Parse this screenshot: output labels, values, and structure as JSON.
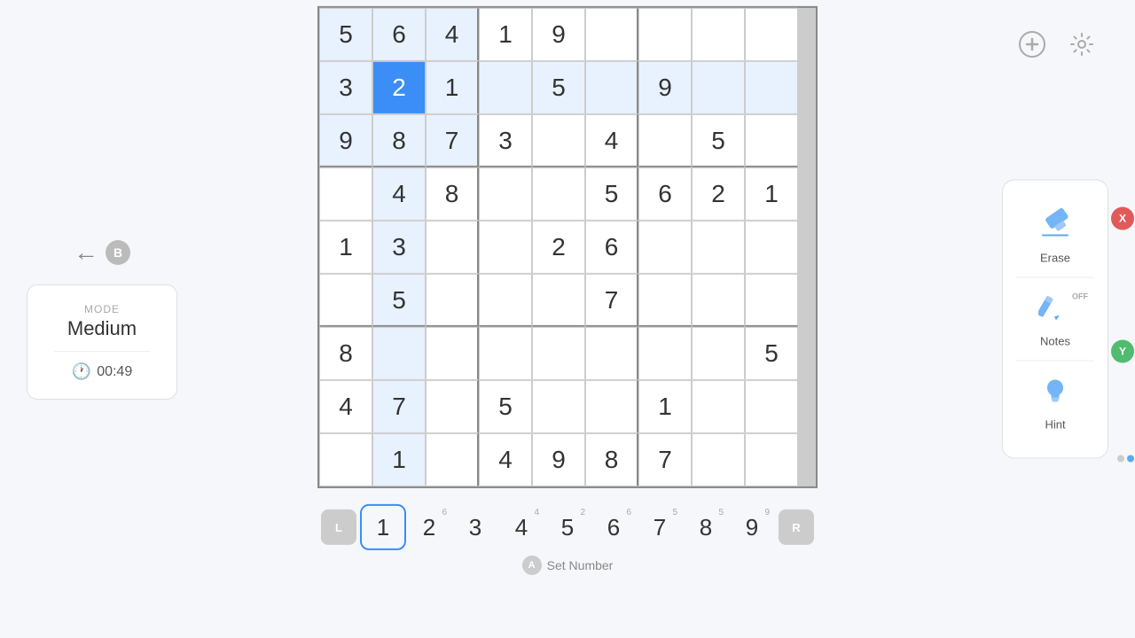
{
  "left": {
    "back_arrow": "←",
    "b_badge": "B",
    "mode_label": "MODE",
    "mode_value": "Medium",
    "timer_time": "00:49"
  },
  "top_right": {
    "add_label": "+",
    "settings_label": "⚙"
  },
  "tools": {
    "erase_label": "Erase",
    "notes_label": "Notes",
    "notes_status": "OFF",
    "hint_label": "Hint",
    "x_badge": "X",
    "y_badge": "Y"
  },
  "grid": {
    "cells": [
      [
        5,
        6,
        4,
        1,
        9,
        "",
        "",
        "",
        ""
      ],
      [
        3,
        2,
        1,
        "",
        5,
        "",
        9,
        "",
        ""
      ],
      [
        9,
        8,
        7,
        3,
        "",
        4,
        "",
        5,
        ""
      ],
      [
        "",
        4,
        8,
        "",
        "",
        5,
        6,
        2,
        1
      ],
      [
        1,
        3,
        "",
        "",
        2,
        6,
        "",
        "",
        ""
      ],
      [
        "",
        5,
        "",
        "",
        "",
        7,
        "",
        "",
        ""
      ],
      [
        8,
        "",
        "",
        "",
        "",
        "",
        "",
        "",
        5
      ],
      [
        4,
        7,
        "",
        5,
        "",
        "",
        1,
        "",
        ""
      ],
      [
        "",
        1,
        "",
        4,
        9,
        8,
        7,
        "",
        ""
      ]
    ],
    "selected_row": 1,
    "selected_col": 1,
    "highlighted_rows_cols": []
  },
  "number_picker": {
    "left_btn": "L",
    "right_btn": "R",
    "numbers": [
      {
        "val": "1",
        "count": ""
      },
      {
        "val": "2",
        "count": "6"
      },
      {
        "val": "3",
        "count": ""
      },
      {
        "val": "4",
        "count": "4"
      },
      {
        "val": "5",
        "count": "2"
      },
      {
        "val": "6",
        "count": "6"
      },
      {
        "val": "7",
        "count": "5"
      },
      {
        "val": "8",
        "count": "5"
      },
      {
        "val": "9",
        "count": "9"
      }
    ],
    "selected_number": 1,
    "set_number_label": "Set Number",
    "a_badge": "A"
  }
}
